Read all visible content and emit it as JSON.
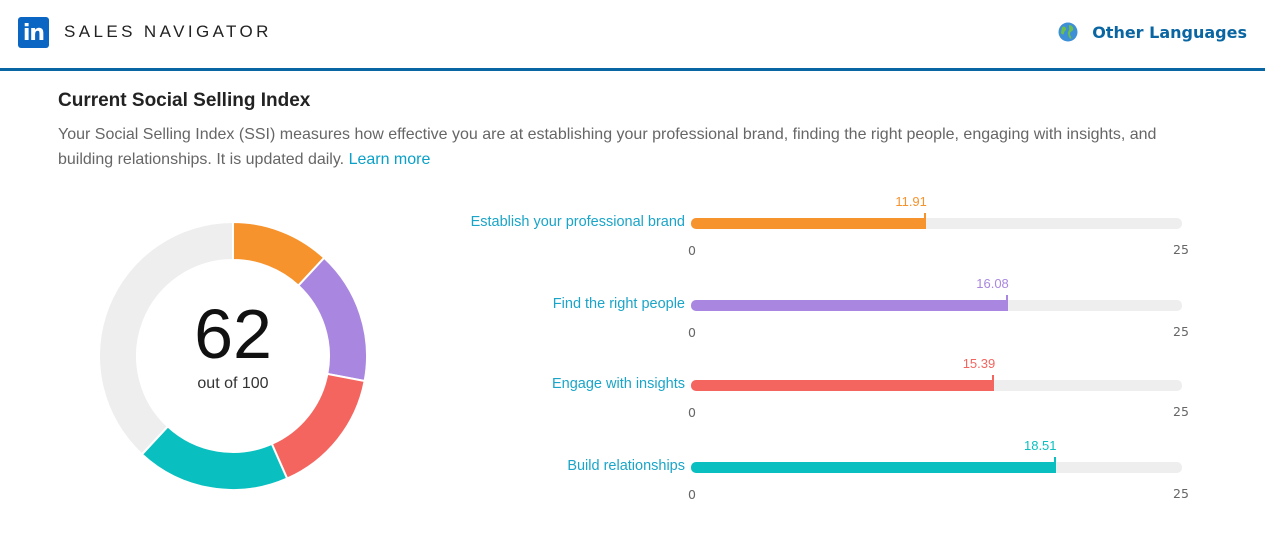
{
  "header": {
    "logo_text": "in",
    "brand": "SALES NAVIGATOR",
    "language_label": "Other Languages"
  },
  "ssi": {
    "title": "Current Social Selling Index",
    "description": "Your Social Selling Index (SSI) measures how effective you are at establishing your professional brand, finding the right people, engaging with insights, and building relationships. It is updated daily.",
    "learn_more": "Learn more",
    "score": "62",
    "score_suffix": "out of 100",
    "score_max": 100,
    "remaining_color": "#eeeeee"
  },
  "pillars": [
    {
      "label": "Establish your professional brand",
      "value": 11.91,
      "value_text": "11.91",
      "min_text": "0",
      "max_text": "25",
      "max": 25,
      "color": "#f7932d"
    },
    {
      "label": "Find the right people",
      "value": 16.08,
      "value_text": "16.08",
      "min_text": "0",
      "max_text": "25",
      "max": 25,
      "color": "#a987e0"
    },
    {
      "label": "Engage with insights",
      "value": 15.39,
      "value_text": "15.39",
      "min_text": "0",
      "max_text": "25",
      "max": 25,
      "color": "#f4655f"
    },
    {
      "label": "Build relationships",
      "value": 18.51,
      "value_text": "18.51",
      "min_text": "0",
      "max_text": "25",
      "max": 25,
      "color": "#0abfbf"
    }
  ]
}
